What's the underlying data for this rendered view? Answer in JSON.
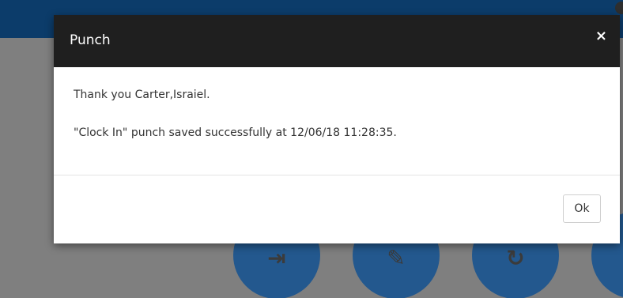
{
  "modal": {
    "title": "Punch",
    "close_icon": "×",
    "message_line1": "Thank you Carter,Israiel.",
    "message_line2": "\"Clock In\" punch saved successfully at 12/06/18 11:28:35.",
    "ok_label": "Ok"
  },
  "background": {
    "action_icons": [
      "logout-icon",
      "edit-icon",
      "refresh-icon",
      "more-icon"
    ]
  },
  "colors": {
    "topbar": "#0c3c6a",
    "overlay_bg": "#7f7f7f",
    "modal_header": "#1f1f1f",
    "action_circle": "#23588e"
  }
}
